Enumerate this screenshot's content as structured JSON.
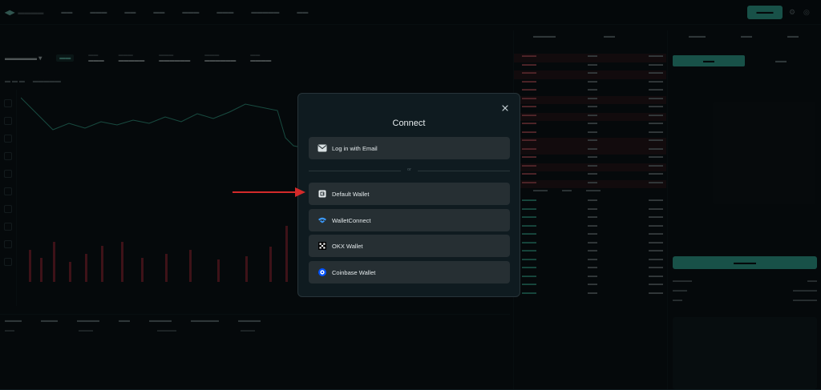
{
  "modal": {
    "title": "Connect",
    "divider_text": "or",
    "options": [
      {
        "label": "Log in with Email",
        "icon": "email-icon"
      },
      {
        "label": "Default Wallet",
        "icon": "wallet-icon"
      },
      {
        "label": "WalletConnect",
        "icon": "walletconnect-icon"
      },
      {
        "label": "OKX Wallet",
        "icon": "okx-icon"
      },
      {
        "label": "Coinbase Wallet",
        "icon": "coinbase-icon"
      }
    ]
  },
  "colors": {
    "accent": "#3fd4bd",
    "ask": "#d9646e",
    "bid": "#3fc4a8",
    "annotation_arrow": "#d42a2a",
    "walletconnect": "#3b99fc",
    "coinbase": "#0052ff"
  }
}
